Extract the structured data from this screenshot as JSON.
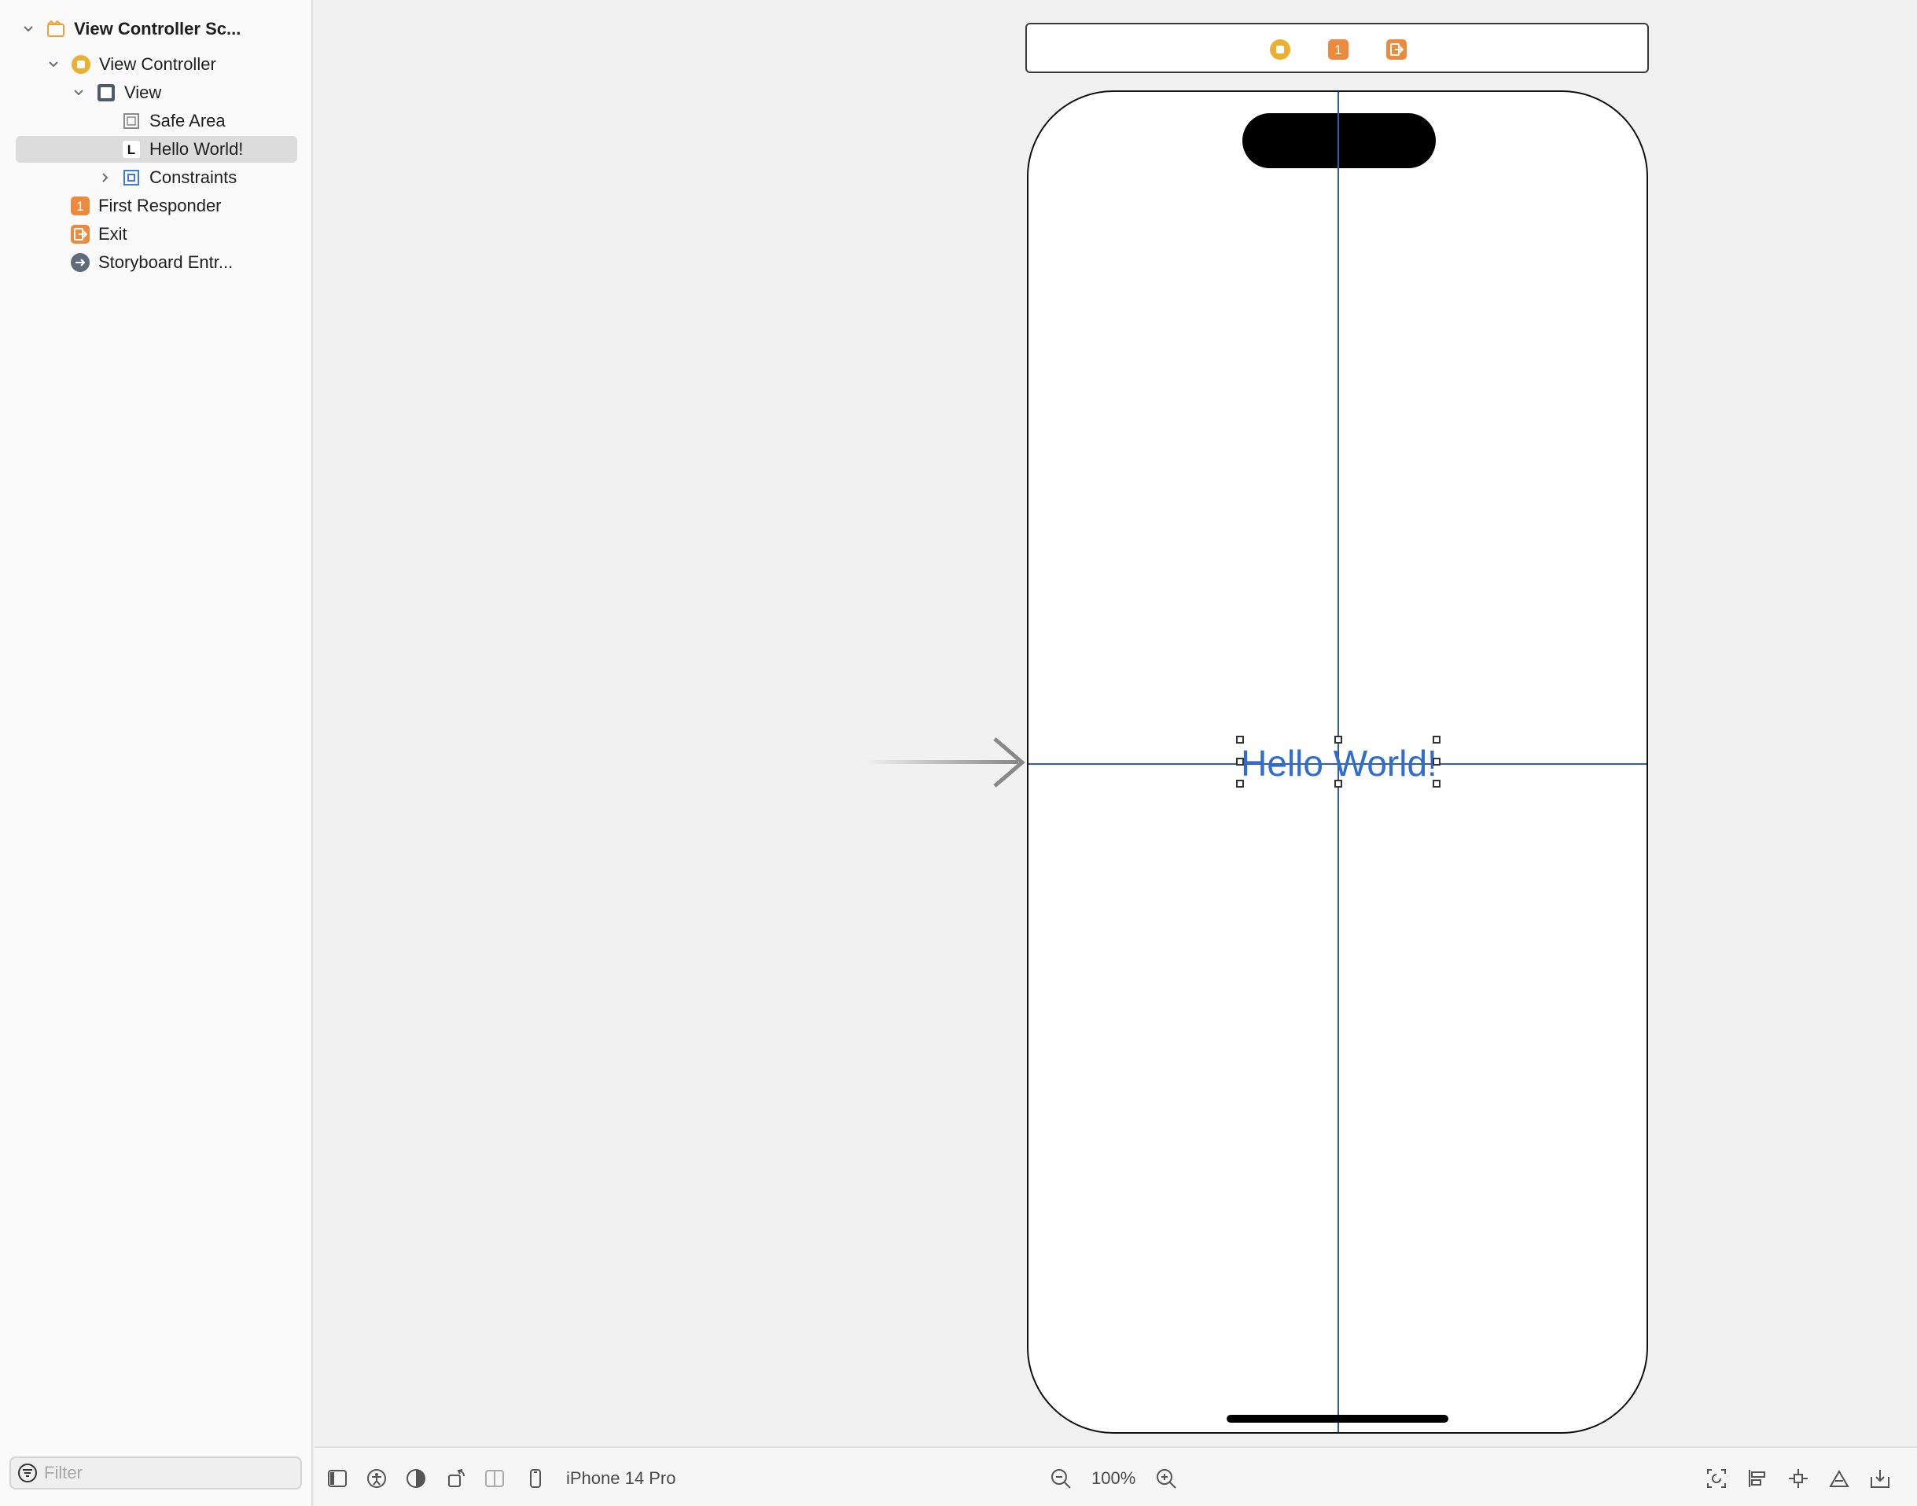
{
  "outline": {
    "items": [
      {
        "label": "View Controller Sc...",
        "icon": "scene-icon",
        "expanded": true
      },
      {
        "label": "View Controller",
        "icon": "view-controller-icon",
        "expanded": true
      },
      {
        "label": "View",
        "icon": "view-icon",
        "expanded": true
      },
      {
        "label": "Safe Area",
        "icon": "safe-area-icon"
      },
      {
        "label": "Hello World!",
        "icon": "label-icon",
        "icon_text": "L",
        "selected": true
      },
      {
        "label": "Constraints",
        "icon": "constraints-icon",
        "expanded": false
      },
      {
        "label": "First Responder",
        "icon": "first-responder-icon",
        "icon_text": "1"
      },
      {
        "label": "Exit",
        "icon": "exit-icon"
      },
      {
        "label": "Storyboard Entr...",
        "icon": "storyboard-entry-icon"
      }
    ],
    "filter_placeholder": "Filter"
  },
  "scene_dock": {
    "icons": [
      {
        "name": "view-controller-icon",
        "color": "#e9b032"
      },
      {
        "name": "first-responder-icon",
        "text": "1",
        "color": "#ec8a3d"
      },
      {
        "name": "exit-icon",
        "color": "#ec8a3d"
      }
    ]
  },
  "canvas": {
    "label_text": "Hello World!",
    "label_color": "#2f6dd0",
    "guide_color": "#2f5bb0"
  },
  "toolbar": {
    "device": "iPhone 14 Pro",
    "zoom": "100%"
  },
  "colors": {
    "accent_orange": "#ec8a3d",
    "accent_yellow": "#e9b032",
    "selection": "#dcdcdc"
  }
}
